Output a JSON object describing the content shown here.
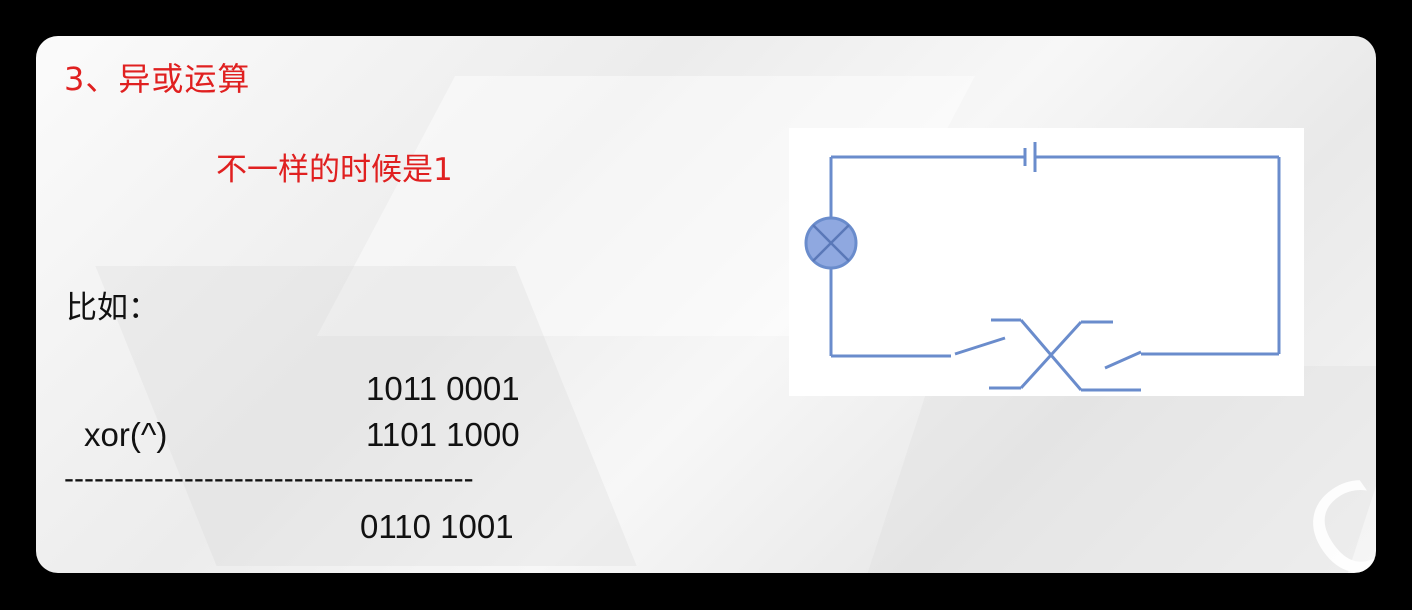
{
  "slide": {
    "title": "3、异或运算",
    "subtitle": "不一样的时候是1",
    "example_label": "比如：",
    "operand_a": "1011 0001",
    "operator_label": "xor(^)",
    "operand_b": "1101 1000",
    "divider": "-----------------------------------------",
    "result": "0110 1001"
  },
  "diagram": {
    "type": "circuit",
    "components": [
      "battery-icon",
      "lamp-icon",
      "switch-left",
      "switch-right",
      "crossover-wires"
    ]
  },
  "colors": {
    "accent_red": "#e02020",
    "wire_blue": "#6a8ccc",
    "lamp_fill": "#8fa8e0"
  }
}
